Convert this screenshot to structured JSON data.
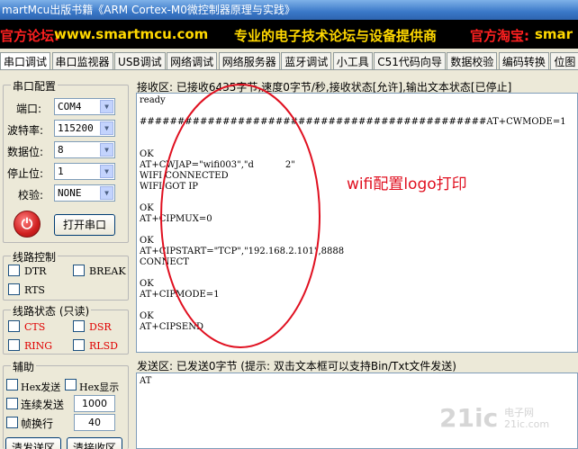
{
  "window": {
    "title": "martMcu出版书籍《ARM Cortex-M0微控制器原理与实践》"
  },
  "banner": {
    "forum_label": "官方论坛:",
    "forum_url": "www.smartmcu.com",
    "slogan": "专业的电子技术论坛与设备提供商",
    "shop_label": "官方淘宝:",
    "shop_url": "smar"
  },
  "tabs": [
    "串口调试",
    "串口监视器",
    "USB调试",
    "网络调试",
    "网络服务器",
    "蓝牙调试",
    "小工具",
    "C51代码向导",
    "数据校验",
    "编码转换",
    "位图"
  ],
  "serial_config": {
    "title": "串口配置",
    "port_label": "端口:",
    "port_value": "COM4",
    "baud_label": "波特率:",
    "baud_value": "115200",
    "databits_label": "数据位:",
    "databits_value": "8",
    "stopbits_label": "停止位:",
    "stopbits_value": "1",
    "parity_label": "校验:",
    "parity_value": "NONE",
    "open_button": "打开串口"
  },
  "line_control": {
    "title": "线路控制",
    "dtr": "DTR",
    "break": "BREAK",
    "rts": "RTS"
  },
  "line_status": {
    "title": "线路状态 (只读)",
    "cts": "CTS",
    "dsr": "DSR",
    "ring": "RING",
    "rlsd": "RLSD"
  },
  "assist": {
    "title": "辅助",
    "hex_send": "Hex发送",
    "hex_display": "Hex显示",
    "auto_send": "连续发送",
    "auto_send_ms": "1000",
    "frame_wrap": "帧换行",
    "frame_wrap_value": "40",
    "clear_send": "清发送区",
    "clear_recv": "清接收区"
  },
  "receive": {
    "status": "接收区: 已接收6435字节,速度0字节/秒,接收状态[允许],输出文本状态[已停止]",
    "text": "ready\n\n##############################################AT+CWMODE=1\n\n\nOK\nAT+CWJAP=\"wifi003\",\"d           2\"\nWIFI CONNECTED\nWIFI GOT IP\n\nOK\nAT+CIPMUX=0\n\nOK\nAT+CIPSTART=\"TCP\",\"192.168.2.101\",8888\nCONNECT\n\nOK\nAT+CIPMODE=1\n\nOK\nAT+CIPSEND"
  },
  "send": {
    "status": "发送区: 已发送0字节 (提示: 双击文本框可以支持Bin/Txt文件发送)",
    "text": "AT"
  },
  "annotation": "wifi配置logo打印",
  "watermark": {
    "main": "21ic",
    "sub1": "电子网",
    "sub2": "21ic.com"
  },
  "colors": {
    "banner_yellow": "#ffd800",
    "banner_red": "#ff2020",
    "annotation_red": "#e01020"
  }
}
